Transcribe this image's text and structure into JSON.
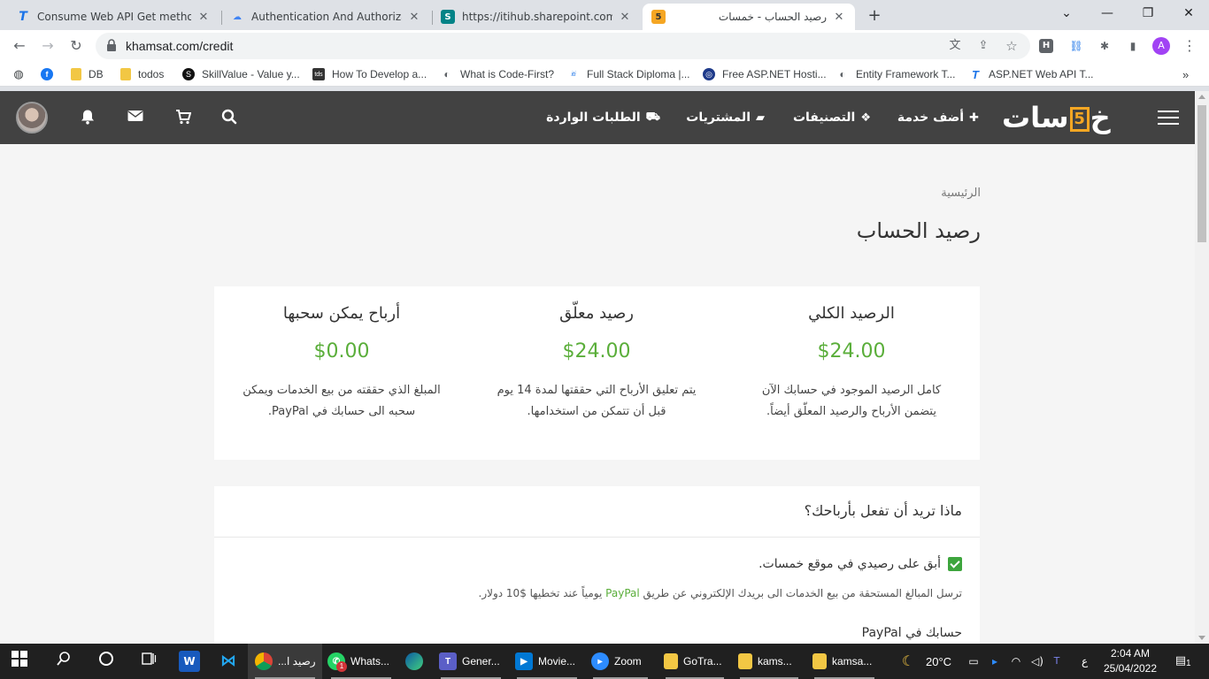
{
  "browser": {
    "tabs": [
      {
        "title": "Consume Web API Get method i",
        "favicon_text": "T",
        "favicon_color": "#1a73e8"
      },
      {
        "title": "Authentication And Authorizatio",
        "favicon_text": "☁",
        "favicon_color": "#4285f4"
      },
      {
        "title": "https://itihub.sharepoint.com/sit",
        "favicon_text": "S",
        "favicon_color": "#038387"
      },
      {
        "title": "رصيد الحساب - خمسات",
        "favicon_text": "5",
        "favicon_color": "#f5a623"
      }
    ],
    "url": "khamsat.com/credit",
    "profile_letter": "A",
    "ext_h": "H",
    "bookmarks": [
      {
        "label": "DB",
        "type": "folder"
      },
      {
        "label": "todos",
        "type": "folder"
      },
      {
        "label": "SkillValue - Value y...",
        "icon": "S"
      },
      {
        "label": "How To Develop a...",
        "icon": "tds"
      },
      {
        "label": "What is Code-First?",
        "icon": "C"
      },
      {
        "label": "Full Stack Diploma |...",
        "icon": "iti"
      },
      {
        "label": "Free ASP.NET Hosti...",
        "icon": "F"
      },
      {
        "label": "Entity Framework T...",
        "icon": "E"
      },
      {
        "label": "ASP.NET Web API T...",
        "icon": "T"
      }
    ]
  },
  "site": {
    "logo_left": "خ",
    "logo_five": "5",
    "logo_right": "سات",
    "nav": {
      "add_service": "أضف خدمة",
      "categories": "التصنيفات",
      "purchases": "المشتريات",
      "incoming": "الطلبات الواردة"
    },
    "accent": "#f5a623",
    "header_bg": "#424242"
  },
  "page": {
    "breadcrumb": "الرئيسية",
    "title": "رصيد الحساب",
    "balances": [
      {
        "title": "الرصيد الكلي",
        "amount": "$24.00",
        "desc": "كامل الرصيد الموجود في حسابك الآن يتضمن الأرباح والرصيد المعلّق أيضاً."
      },
      {
        "title": "رصيد معلّق",
        "amount": "$24.00",
        "desc": "يتم تعليق الأرباح التي حققتها لمدة 14 يوم قبل أن تتمكن من استخدامها."
      },
      {
        "title": "أرباح يمكن سحبها",
        "amount": "$0.00",
        "desc": "المبلغ الذي حققته من بيع الخدمات ويمكن سحبه الى حسابك في PayPal."
      }
    ],
    "amount_color": "#5aae3a",
    "earnings": {
      "title": "ماذا تريد أن تفعل بأرباحك؟",
      "option_label": "أبق على رصيدي في موقع خمسات.",
      "option_desc_before": "ترسل المبالغ المستحقة من بيع الخدمات الى بريدك الإلكتروني عن طريق ",
      "option_desc_paypal": "PayPal",
      "option_desc_after": " يومياً عند تخطيها $10 دولار.",
      "paypal_account_label": "حسابك في PayPal"
    }
  },
  "taskbar": {
    "apps": [
      {
        "label": "رصيد ا...",
        "icon": "chrome"
      },
      {
        "label": "Whats...",
        "icon": "whatsapp",
        "badge": "1"
      },
      {
        "label": "",
        "icon": "edge"
      },
      {
        "label": "Gener...",
        "icon": "teams"
      },
      {
        "label": "Movie...",
        "icon": "video"
      },
      {
        "label": "Zoom",
        "icon": "zoom"
      },
      {
        "label": "GoTra...",
        "icon": "folder"
      },
      {
        "label": "kams...",
        "icon": "folder"
      },
      {
        "label": "kamsa...",
        "icon": "folder"
      }
    ],
    "weather": "20°C",
    "lang": "ع",
    "time": "2:04 AM",
    "date": "25/04/2022",
    "notif_count": "1"
  }
}
